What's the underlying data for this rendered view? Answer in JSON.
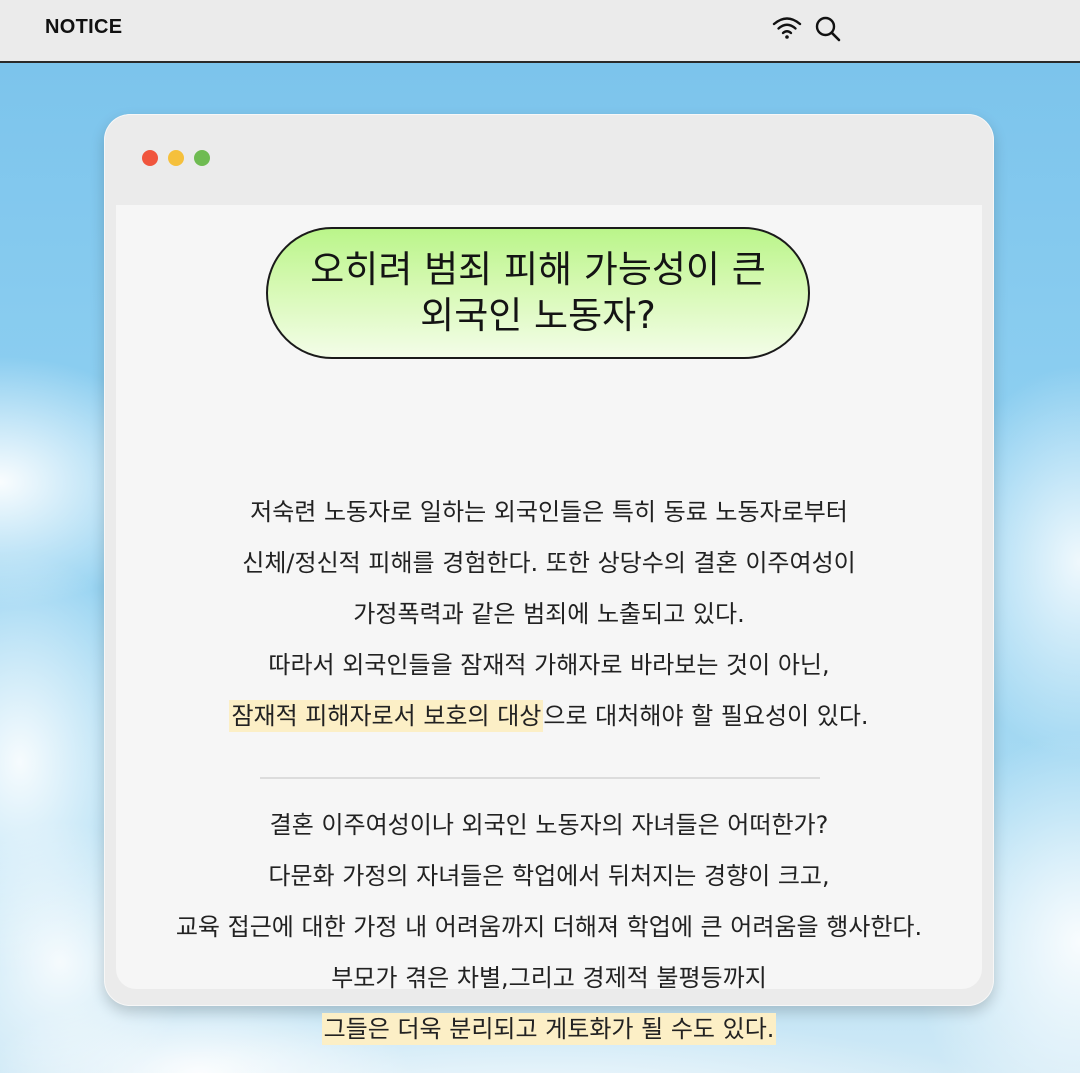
{
  "topbar": {
    "title": "NOTICE",
    "icons": [
      "wifi-icon",
      "search-icon"
    ]
  },
  "window": {
    "dots": [
      "#f0553d",
      "#f5c03c",
      "#6fbb52"
    ],
    "heading": {
      "line1": "오히려 범죄 피해 가능성이 큰",
      "line2": "외국인 노동자?"
    },
    "para1": {
      "line1": "저숙련 노동자로 일하는 외국인들은 특히 동료 노동자로부터",
      "line2": "신체/정신적 피해를 경험한다. 또한 상당수의 결혼 이주여성이",
      "line3": "가정폭력과 같은 범죄에 노출되고 있다.",
      "line4": "따라서 외국인들을 잠재적 가해자로 바라보는 것이 아닌,",
      "line5_highlight": "잠재적 피해자로서 보호의 대상",
      "line5_rest": "으로 대처해야 할 필요성이 있다."
    },
    "para2": {
      "line1": "결혼 이주여성이나 외국인 노동자의 자녀들은 어떠한가?",
      "line2": "다문화 가정의 자녀들은 학업에서 뒤처지는 경향이 크고,",
      "line3": "교육 접근에 대한 가정 내 어려움까지 더해져 학업에 큰 어려움을 행사한다.",
      "line4": "부모가 겪은 차별,그리고 경제적 불평등까지",
      "line5_highlight": "그들은 더욱 분리되고 게토화가 될 수도 있다."
    }
  },
  "colors": {
    "pill_green": "#baf58a",
    "highlight": "#fcefc6",
    "sky": "#8ccdef"
  }
}
